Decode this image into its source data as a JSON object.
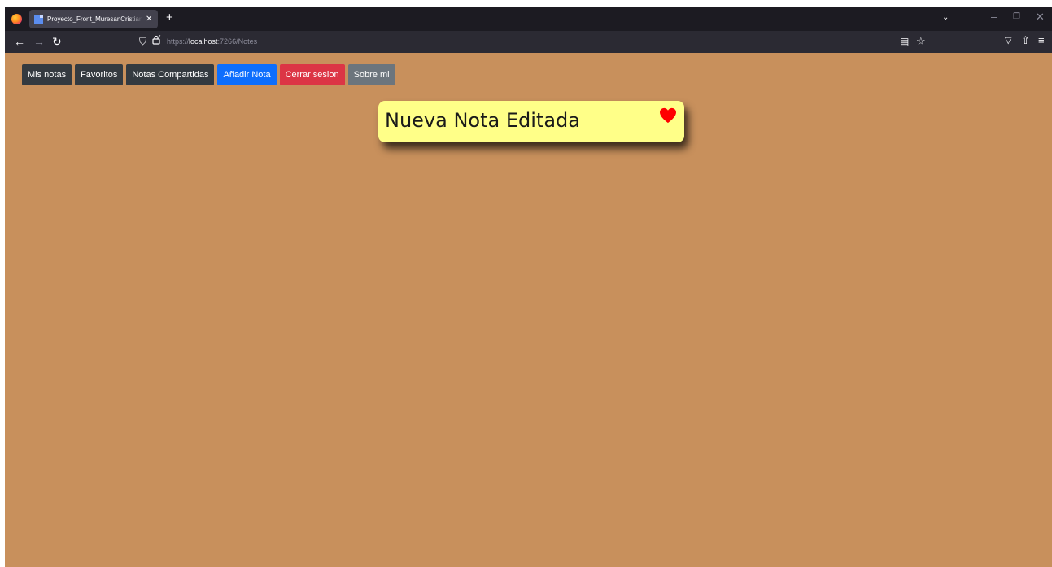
{
  "browser": {
    "tab_title": "Proyecto_Front_MuresanCristian",
    "tab_close": "✕",
    "new_tab": "+",
    "url_prefix": "https://",
    "url_host": "localhost",
    "url_path": ":7266/Notes",
    "icons": {
      "back": "←",
      "forward": "→",
      "reload": "↻",
      "shield": "⛉",
      "lock": "🔒",
      "reader": "▤",
      "star": "☆",
      "pocket": "▽",
      "extensions": "⇧",
      "menu": "≡",
      "list_tabs": "⌄",
      "minimize": "–",
      "restore": "❐",
      "close": "✕"
    }
  },
  "nav": {
    "items": [
      {
        "label": "Mis notas",
        "style": "dark"
      },
      {
        "label": "Favoritos",
        "style": "dark"
      },
      {
        "label": "Notas Compartidas",
        "style": "dark"
      },
      {
        "label": "Añadir Nota",
        "style": "primary"
      },
      {
        "label": "Cerrar sesion",
        "style": "danger"
      },
      {
        "label": "Sobre mi",
        "style": "secondary"
      }
    ]
  },
  "note": {
    "title": "Nueva Nota Editada",
    "favorite": true,
    "heart_color": "#ff0000"
  },
  "colors": {
    "page_background": "#c8905c",
    "note_background": "#ffff88"
  }
}
